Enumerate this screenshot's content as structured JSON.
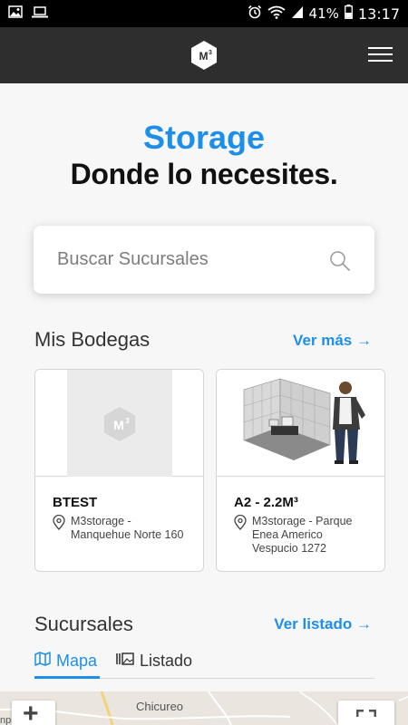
{
  "status_bar": {
    "battery": "41%",
    "time": "13:17"
  },
  "header": {
    "logo_text": "M3"
  },
  "hero": {
    "title": "Storage",
    "subtitle": "Donde lo necesites."
  },
  "search": {
    "placeholder": "Buscar Sucursales"
  },
  "mis_bodegas": {
    "title": "Mis Bodegas",
    "link": "Ver más →",
    "cards": [
      {
        "title": "BTEST",
        "location": "M3storage - Manquehue Norte 160"
      },
      {
        "title": "A2 - 2.2M³",
        "location": "M3storage - Parque Enea Americo Vespucio 1272"
      }
    ]
  },
  "sucursales": {
    "title": "Sucursales",
    "link": "Ver listado →",
    "tabs": [
      {
        "label": "Mapa",
        "active": true
      },
      {
        "label": "Listado",
        "active": false
      }
    ]
  },
  "map": {
    "place_label": "Chicureo",
    "edge_label": "np",
    "zoom_in": "+"
  },
  "colors": {
    "accent": "#1e8fe8",
    "header_bg": "#2e2e2e",
    "page_bg": "#f7f7f7"
  }
}
